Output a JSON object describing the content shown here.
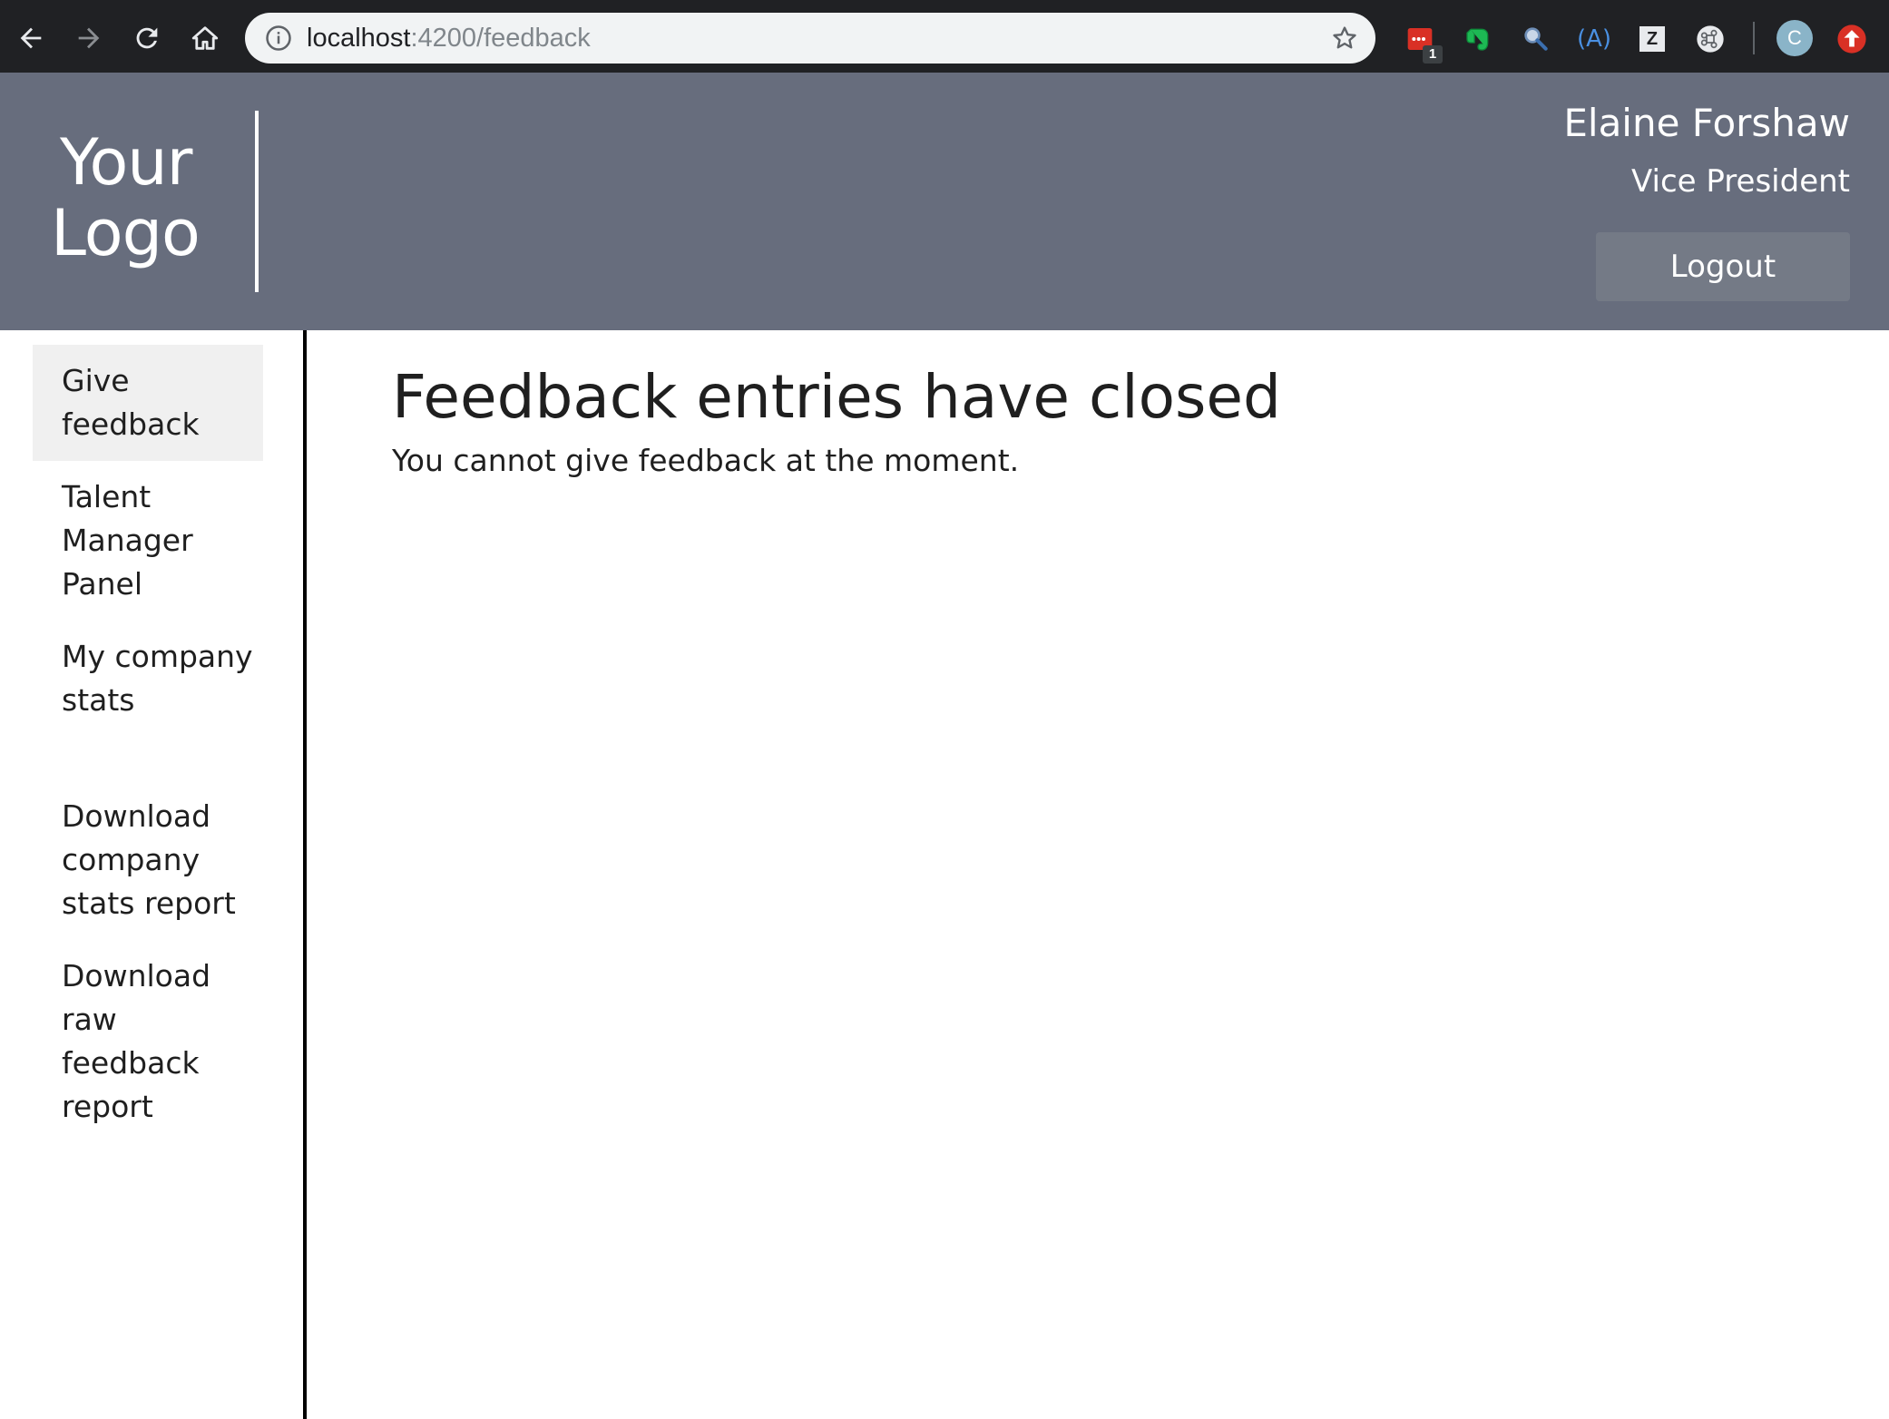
{
  "browser": {
    "url_host": "localhost",
    "url_path": ":4200/feedback",
    "extension_badge": "1",
    "profile_initial": "C",
    "ext_text_icon": "(A)",
    "ext_z_icon": "Z"
  },
  "header": {
    "logo_line1": "Your",
    "logo_line2": "Logo",
    "user_name": "Elaine Forshaw",
    "user_role": "Vice President",
    "logout_label": "Logout",
    "background_color": "#676d7d"
  },
  "sidebar": {
    "items": [
      {
        "label": "Give feedback",
        "active": true
      },
      {
        "label": "Talent Manager Panel",
        "active": false
      },
      {
        "label": "My company stats",
        "active": false
      },
      {
        "label": "Download company stats report",
        "active": false
      },
      {
        "label": "Download raw feedback report",
        "active": false
      }
    ]
  },
  "main": {
    "title": "Feedback entries have closed",
    "message": "You cannot give feedback at the moment."
  }
}
